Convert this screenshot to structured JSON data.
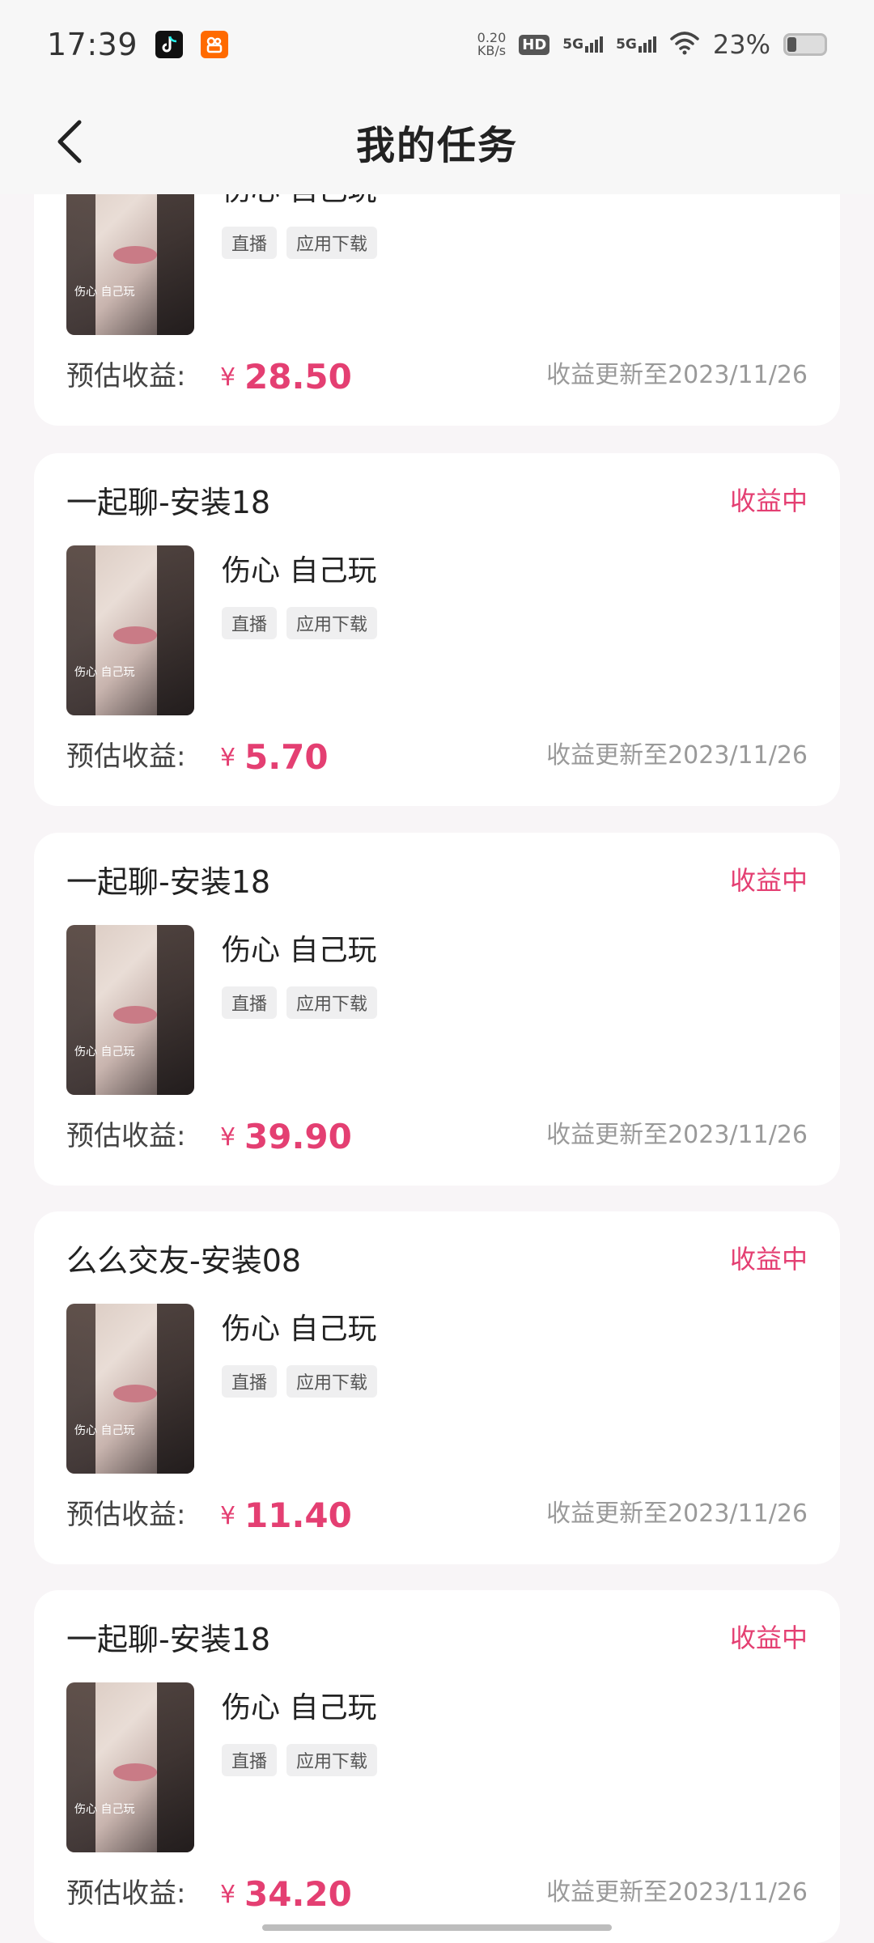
{
  "status_bar": {
    "time": "17:39",
    "netspeed_value": "0.20",
    "netspeed_unit": "KB/s",
    "hd_label": "HD",
    "network_1": "5G",
    "network_2": "5G",
    "battery_pct": "23%"
  },
  "nav": {
    "title": "我的任务"
  },
  "tasks": [
    {
      "title": "",
      "status": "",
      "video_title": "伤心 自己玩",
      "thumb_caption": "伤心 自己玩",
      "tags": [
        "直播",
        "应用下载"
      ],
      "earn_label": "预估收益:",
      "currency": "¥",
      "earnings": "28.50",
      "update_text": "收益更新至2023/11/26"
    },
    {
      "title": "一起聊-安装18",
      "status": "收益中",
      "video_title": "伤心 自己玩",
      "thumb_caption": "伤心 自己玩",
      "tags": [
        "直播",
        "应用下载"
      ],
      "earn_label": "预估收益:",
      "currency": "¥",
      "earnings": "5.70",
      "update_text": "收益更新至2023/11/26"
    },
    {
      "title": "一起聊-安装18",
      "status": "收益中",
      "video_title": "伤心 自己玩",
      "thumb_caption": "伤心 自己玩",
      "tags": [
        "直播",
        "应用下载"
      ],
      "earn_label": "预估收益:",
      "currency": "¥",
      "earnings": "39.90",
      "update_text": "收益更新至2023/11/26"
    },
    {
      "title": "么么交友-安装08",
      "status": "收益中",
      "video_title": "伤心 自己玩",
      "thumb_caption": "伤心 自己玩",
      "tags": [
        "直播",
        "应用下载"
      ],
      "earn_label": "预估收益:",
      "currency": "¥",
      "earnings": "11.40",
      "update_text": "收益更新至2023/11/26"
    },
    {
      "title": "一起聊-安装18",
      "status": "收益中",
      "video_title": "伤心 自己玩",
      "thumb_caption": "伤心 自己玩",
      "tags": [
        "直播",
        "应用下载"
      ],
      "earn_label": "预估收益:",
      "currency": "¥",
      "earnings": "34.20",
      "update_text": "收益更新至2023/11/26"
    }
  ],
  "colors": {
    "accent": "#e43f72",
    "background": "#f8f5f7",
    "card": "#ffffff"
  }
}
